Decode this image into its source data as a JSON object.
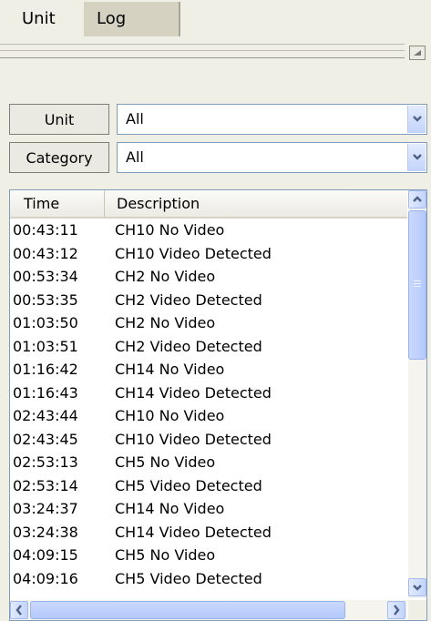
{
  "tabs": {
    "unit_label": "Unit",
    "log_label": "Log"
  },
  "filters": {
    "unit_label": "Unit",
    "unit_value": "All",
    "category_label": "Category",
    "category_value": "All"
  },
  "log_table": {
    "columns": {
      "time": "Time",
      "description": "Description"
    },
    "rows": [
      {
        "time": "00:43:11",
        "description": "CH10 No Video"
      },
      {
        "time": "00:43:12",
        "description": "CH10 Video Detected"
      },
      {
        "time": "00:53:34",
        "description": "CH2 No Video"
      },
      {
        "time": "00:53:35",
        "description": "CH2 Video Detected"
      },
      {
        "time": "01:03:50",
        "description": "CH2 No Video"
      },
      {
        "time": "01:03:51",
        "description": "CH2 Video Detected"
      },
      {
        "time": "01:16:42",
        "description": "CH14 No Video"
      },
      {
        "time": "01:16:43",
        "description": "CH14 Video Detected"
      },
      {
        "time": "02:43:44",
        "description": "CH10 No Video"
      },
      {
        "time": "02:43:45",
        "description": "CH10 Video Detected"
      },
      {
        "time": "02:53:13",
        "description": "CH5 No Video"
      },
      {
        "time": "02:53:14",
        "description": "CH5 Video Detected"
      },
      {
        "time": "03:24:37",
        "description": "CH14 No Video"
      },
      {
        "time": "03:24:38",
        "description": "CH14 Video Detected"
      },
      {
        "time": "04:09:15",
        "description": "CH5 No Video"
      },
      {
        "time": "04:09:16",
        "description": "CH5 Video Detected"
      }
    ]
  },
  "icons": {
    "dropdown": "chevron-down-icon",
    "scroll_up": "arrow-up-icon",
    "scroll_down": "arrow-down-icon",
    "scroll_left": "arrow-left-icon",
    "scroll_right": "arrow-right-icon",
    "collapse": "triangle-up-icon"
  },
  "colors": {
    "accent": "#c2d3fc",
    "background": "#f0efe6"
  }
}
